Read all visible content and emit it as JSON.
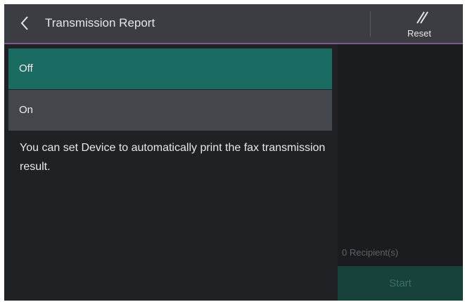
{
  "header": {
    "title": "Transmission Report",
    "back_icon": "chevron-left-icon",
    "reset_label": "Reset",
    "reset_icon": "double-slash-icon"
  },
  "options": [
    {
      "label": "Off",
      "selected": true
    },
    {
      "label": "On",
      "selected": false
    }
  ],
  "description": "You can set Device to automatically print the fax transmission result.",
  "side_panel": {
    "recipients": "0 Recipient(s)",
    "start_label": "Start"
  },
  "colors": {
    "selected": "#1a6b62",
    "unselected": "#43464a",
    "header": "#3b3d42",
    "accent_line": "#7a5a8c",
    "start_button": "#17423c"
  }
}
